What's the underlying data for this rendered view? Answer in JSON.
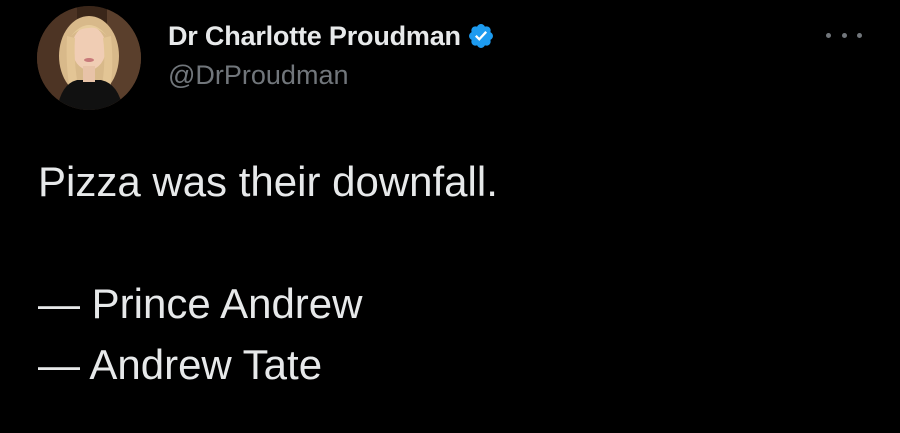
{
  "author": {
    "display_name": "Dr Charlotte Proudman",
    "handle": "@DrProudman",
    "verified": true,
    "verified_color": "#1d9bf0"
  },
  "more_icon": "more-horizontal-icon",
  "tweet": {
    "lines": [
      "Pizza was their downfall.",
      "— Prince Andrew",
      "— Andrew Tate"
    ]
  },
  "colors": {
    "background": "#000000",
    "primary_text": "#e7e9ea",
    "secondary_text": "#71767b"
  }
}
